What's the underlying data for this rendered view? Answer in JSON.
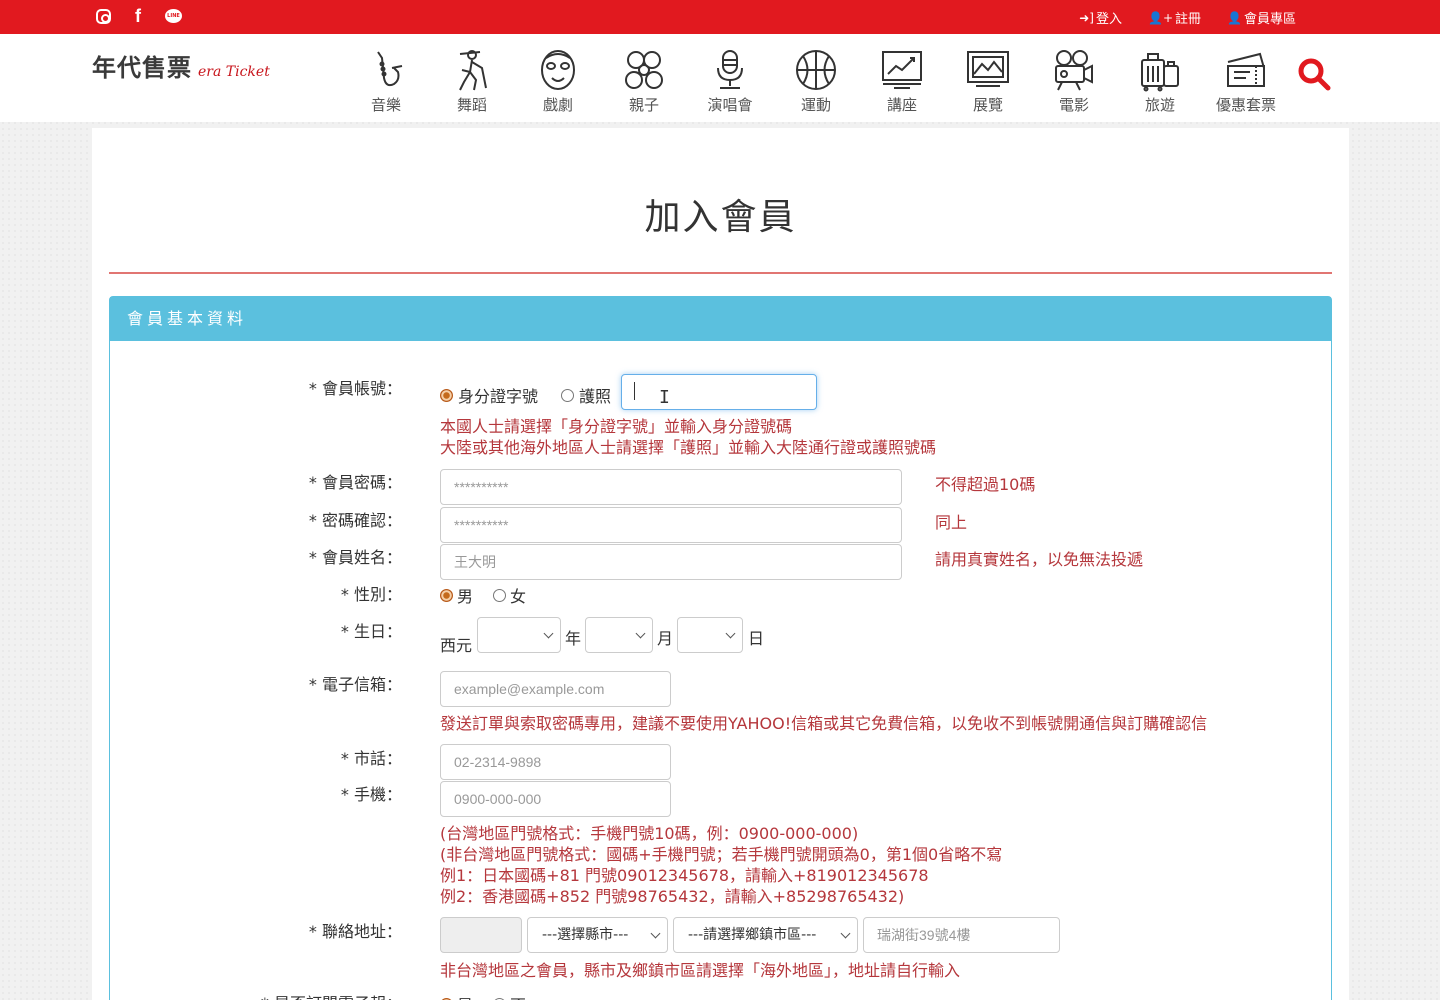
{
  "social": {
    "icons": [
      "instagram-icon",
      "facebook-icon",
      "line-icon"
    ],
    "line_text": "LINE"
  },
  "account": {
    "login": "登入",
    "register": "註冊",
    "member_area": "會員專區"
  },
  "logo": {
    "zh": "年代售票",
    "en": "era Ticket"
  },
  "nav": [
    {
      "label": "音樂",
      "icon": "saxophone-icon"
    },
    {
      "label": "舞蹈",
      "icon": "dancer-icon"
    },
    {
      "label": "戲劇",
      "icon": "mask-icon"
    },
    {
      "label": "親子",
      "icon": "family-icon"
    },
    {
      "label": "演唱會",
      "icon": "microphone-icon"
    },
    {
      "label": "運動",
      "icon": "basketball-icon"
    },
    {
      "label": "講座",
      "icon": "presentation-icon"
    },
    {
      "label": "展覽",
      "icon": "gallery-icon"
    },
    {
      "label": "電影",
      "icon": "projector-icon"
    },
    {
      "label": "旅遊",
      "icon": "luggage-icon"
    },
    {
      "label": "優惠套票",
      "icon": "ticket-icon"
    }
  ],
  "page": {
    "title": "加入會員",
    "section": "會員基本資料"
  },
  "colors": {
    "brand_red": "#e1191f",
    "hint_red": "#b5373c",
    "section_blue": "#5bc0de"
  },
  "form": {
    "account": {
      "label": "* 會員帳號：",
      "opt_id": "身分證字號",
      "opt_passport": "護照",
      "value": "",
      "hint1": "本國人士請選擇「身分證字號」並輸入身分證號碼",
      "hint2": "大陸或其他海外地區人士請選擇「護照」並輸入大陸通行證或護照號碼"
    },
    "password": {
      "label": "* 會員密碼：",
      "placeholder": "**********",
      "hint": "不得超過10碼"
    },
    "password_confirm": {
      "label": "* 密碼確認：",
      "placeholder": "**********",
      "hint": "同上"
    },
    "name": {
      "label": "* 會員姓名：",
      "placeholder": "王大明",
      "hint": "請用真實姓名，以免無法投遞"
    },
    "gender": {
      "label": "* 性別：",
      "male": "男",
      "female": "女",
      "selected": "男"
    },
    "birthday": {
      "label": "* 生日：",
      "era": "西元",
      "year": "年",
      "month": "月",
      "day": "日"
    },
    "email": {
      "label": "* 電子信箱：",
      "placeholder": "example@example.com",
      "hint": "發送訂單與索取密碼專用，建議不要使用YAHOO!信箱或其它免費信箱，以免收不到帳號開通信與訂購確認信"
    },
    "phone": {
      "label": "* 市話：",
      "placeholder": "02-2314-9898"
    },
    "mobile": {
      "label": "* 手機：",
      "placeholder": "0900-000-000",
      "hints": [
        "(台灣地區門號格式：手機門號10碼，例：0900-000-000)",
        "(非台灣地區門號格式：國碼+手機門號；若手機門號開頭為0，第1個0省略不寫",
        "例1：日本國碼+81 門號09012345678，請輸入+819012345678",
        "例2：香港國碼+852 門號98765432，請輸入+85298765432)"
      ]
    },
    "address": {
      "label": "* 聯絡地址：",
      "county": "---選擇縣市---",
      "district": "---請選擇鄉鎮市區---",
      "placeholder": "瑞湖街39號4樓",
      "hint": "非台灣地區之會員，縣市及鄉鎮市區請選擇「海外地區」，地址請自行輸入"
    },
    "newsletter": {
      "label": "* 是否訂閱電子報：",
      "yes": "是",
      "no": "否"
    }
  }
}
